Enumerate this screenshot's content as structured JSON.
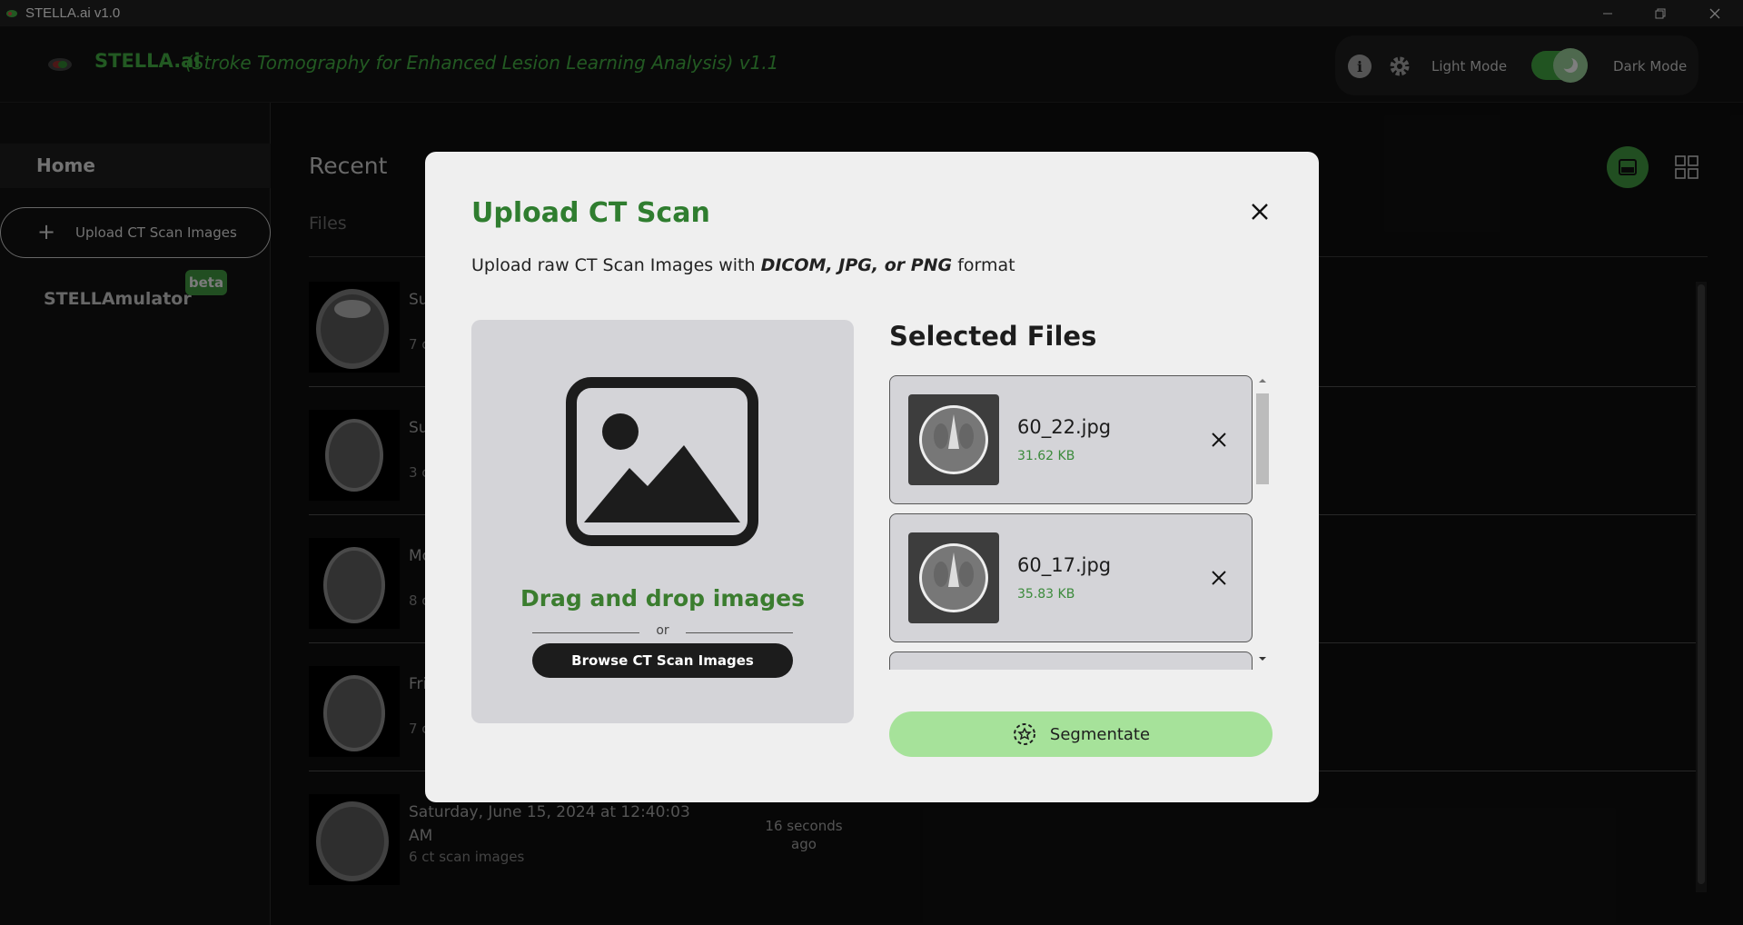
{
  "window": {
    "title": "STELLA.ai v1.0"
  },
  "header": {
    "brand": "STELLA.ai",
    "subtitle": "(Stroke Tomography for Enhanced Lesion Learning Analysis) v1.1",
    "light_mode_label": "Light Mode",
    "dark_mode_label": "Dark Mode",
    "dark_mode_on": true
  },
  "sidebar": {
    "home_label": "Home",
    "upload_label": "Upload CT Scan Images",
    "stellamulator_label": "STELLAmulator",
    "beta_label": "beta"
  },
  "main": {
    "recent_label": "Recent",
    "files_label": "Files",
    "rows": [
      {
        "title": "Su",
        "subtitle": "7 c",
        "ago": ""
      },
      {
        "title": "Su",
        "subtitle": "3 c",
        "ago": ""
      },
      {
        "title": "Mo",
        "subtitle": "8 c",
        "ago": ""
      },
      {
        "title": "Fri",
        "subtitle": "7 c",
        "ago": ""
      },
      {
        "title": "Saturday, June 15, 2024 at 12:40:03 AM",
        "subtitle": "6 ct scan images",
        "ago": "16 seconds ago"
      }
    ]
  },
  "modal": {
    "title": "Upload CT Scan",
    "desc_prefix": "Upload raw CT Scan Images with ",
    "desc_formats": "DICOM, JPG, or PNG",
    "desc_suffix": " format",
    "drop_title": "Drag and drop images",
    "or_label": "or",
    "browse_label": "Browse CT Scan Images",
    "selected_title": "Selected Files",
    "files": [
      {
        "name": "60_22.jpg",
        "size": "31.62 KB"
      },
      {
        "name": "60_17.jpg",
        "size": "35.83 KB"
      }
    ],
    "segmentate_label": "Segmentate"
  },
  "colors": {
    "accent": "#3fa33f",
    "segment_button": "#a6e29a"
  }
}
